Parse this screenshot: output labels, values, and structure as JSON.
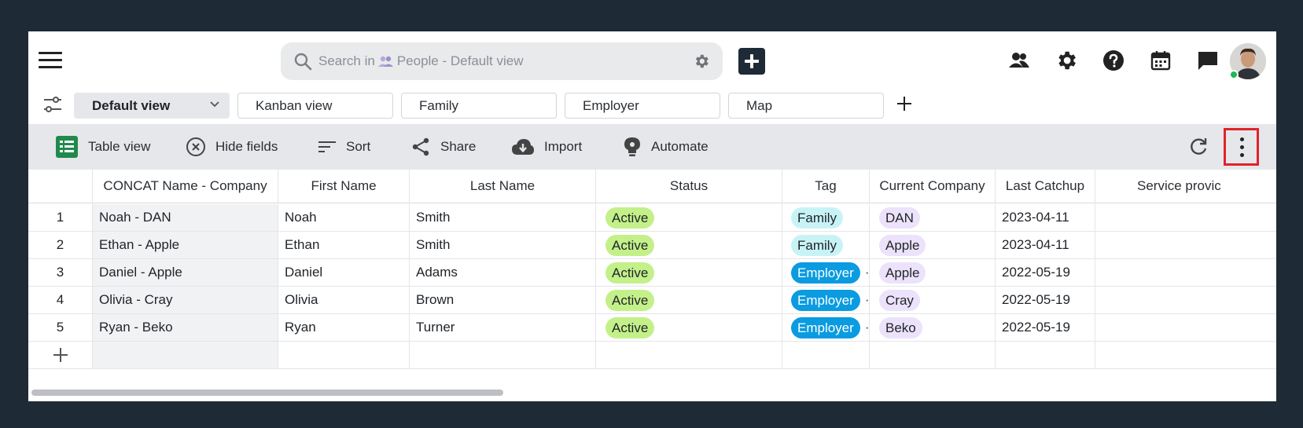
{
  "search": {
    "placeholder_prefix": "Search in",
    "scope": "People - Default view"
  },
  "views": {
    "tabs": [
      {
        "label": "Default view",
        "active": true
      },
      {
        "label": "Kanban view",
        "active": false
      },
      {
        "label": "Family",
        "active": false
      },
      {
        "label": "Employer",
        "active": false
      },
      {
        "label": "Map",
        "active": false
      }
    ]
  },
  "toolbar": {
    "table_view": "Table view",
    "hide_fields": "Hide fields",
    "sort": "Sort",
    "share": "Share",
    "import": "Import",
    "automate": "Automate"
  },
  "table": {
    "columns": [
      "",
      "CONCAT Name - Company",
      "First Name",
      "Last Name",
      "Status",
      "Tag",
      "Current Company",
      "Last Catchup",
      "Service provic"
    ],
    "rows": [
      {
        "num": "1",
        "concat": "Noah - DAN",
        "first": "Noah",
        "last": "Smith",
        "status": "Active",
        "tag": "Family",
        "company": "DAN",
        "catchup": "2023-04-11"
      },
      {
        "num": "2",
        "concat": "Ethan - Apple",
        "first": "Ethan",
        "last": "Smith",
        "status": "Active",
        "tag": "Family",
        "company": "Apple",
        "catchup": "2023-04-11"
      },
      {
        "num": "3",
        "concat": "Daniel - Apple",
        "first": "Daniel",
        "last": "Adams",
        "status": "Active",
        "tag": "Employer",
        "company": "Apple",
        "catchup": "2022-05-19"
      },
      {
        "num": "4",
        "concat": "Olivia - Cray",
        "first": "Olivia",
        "last": "Brown",
        "status": "Active",
        "tag": "Employer",
        "company": "Cray",
        "catchup": "2022-05-19"
      },
      {
        "num": "5",
        "concat": "Ryan - Beko",
        "first": "Ryan",
        "last": "Turner",
        "status": "Active",
        "tag": "Employer",
        "company": "Beko",
        "catchup": "2022-05-19"
      }
    ]
  },
  "colors": {
    "page_bg": "#1e2a36",
    "status_active": "#c4f08a",
    "tag_family": "#c8f3f6",
    "tag_employer": "#0a9be0",
    "company_pill": "#ece2fb",
    "highlight_box": "#e0232b"
  },
  "icons": [
    "hamburger-icon",
    "search-icon",
    "settings-gear-icon",
    "add-icon",
    "people-icon",
    "help-icon",
    "calendar-icon",
    "chat-icon",
    "filter-sliders-icon",
    "chevron-down-icon",
    "table-grid-icon",
    "hide-fields-icon",
    "sort-icon",
    "share-icon",
    "cloud-download-icon",
    "automate-bulb-icon",
    "refresh-icon",
    "more-vertical-icon"
  ]
}
